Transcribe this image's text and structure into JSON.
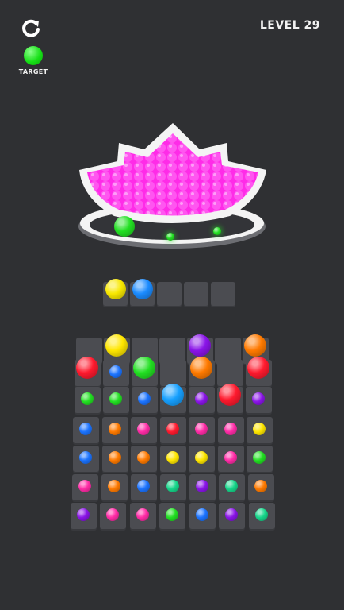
{
  "hud": {
    "level_label": "LEVEL 29",
    "target_label": "TARGET",
    "restart_icon": "restart-icon"
  },
  "target": {
    "color": "#18e018"
  },
  "figure": {
    "fill_color": "#ff2ae8",
    "shape": "lotus-bowl"
  },
  "tray": {
    "slots": 5,
    "balls": [
      "#f8e800",
      "#1b8bff"
    ]
  },
  "palette": {
    "Y": "#ffe600",
    "O": "#ff7a00",
    "P": "#8a14e8",
    "R": "#ff1a2e",
    "B": "#1b73ff",
    "G": "#22e022",
    "M": "#ff2ba6",
    "T": "#16d68a",
    "BB": "#16a0ff"
  },
  "board": {
    "cols": 7,
    "rows": [
      [
        "",
        "Y",
        "",
        "",
        "P",
        "",
        "O"
      ],
      [
        "R",
        "B",
        "G",
        "",
        "O",
        "",
        "R"
      ],
      [
        "G",
        "G",
        "B",
        "BB",
        "P",
        "R",
        "P"
      ],
      [
        "B",
        "O",
        "M",
        "R",
        "M",
        "M",
        "Y"
      ],
      [
        "B",
        "O",
        "O",
        "Y",
        "Y",
        "M",
        "G"
      ],
      [
        "M",
        "O",
        "B",
        "T",
        "P",
        "T",
        "O"
      ],
      [
        "P",
        "M",
        "M",
        "G",
        "B",
        "P",
        "T"
      ]
    ],
    "big": [
      [
        0,
        1
      ],
      [
        0,
        4
      ],
      [
        0,
        6
      ],
      [
        1,
        0
      ],
      [
        1,
        2
      ],
      [
        1,
        4
      ],
      [
        1,
        6
      ],
      [
        2,
        3
      ],
      [
        2,
        5
      ]
    ]
  },
  "figure_balls": [
    {
      "color": "#22e022",
      "size": "large"
    },
    {
      "color": "#22e022",
      "size": "small"
    },
    {
      "color": "#22e022",
      "size": "small"
    }
  ]
}
